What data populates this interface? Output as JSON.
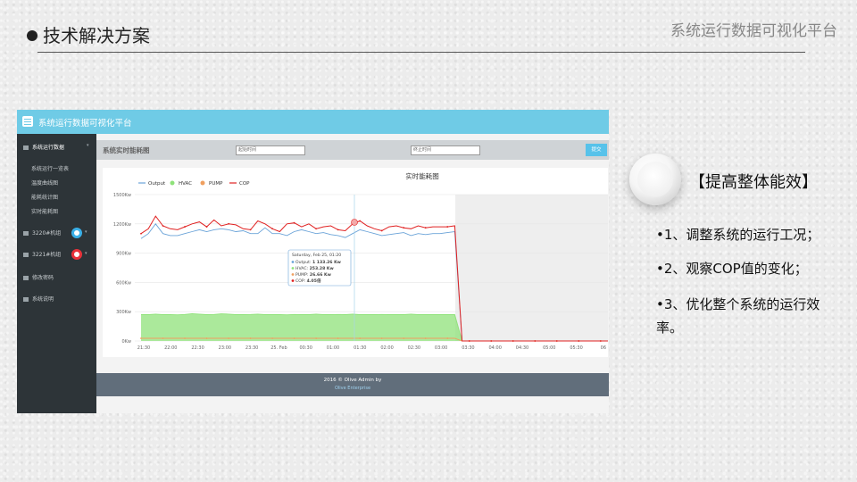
{
  "slide": {
    "title": "技术解决方案",
    "brand": "系统运行数据可视化平台",
    "heading": "【提高整体能效】",
    "bullets": [
      "•1、调整系统的运行工况；",
      "•2、观察COP值的变化；",
      "•3、优化整个系统的运行效率。"
    ]
  },
  "app": {
    "title": "系统运行数据可视化平台",
    "sidebar": {
      "section": "系统运行数据",
      "subitems": [
        "系统运行一览表",
        "温度曲线图",
        "能耗统计图",
        "实时能耗图"
      ],
      "units": [
        {
          "label": "3220#机组",
          "ring_color": "#3ab0e8"
        },
        {
          "label": "3221#机组",
          "ring_color": "#e8323a"
        }
      ],
      "password": "修改密码",
      "manual": "系统说明"
    },
    "filter": {
      "label": "系统实时能耗图",
      "start_placeholder": "起始时间",
      "end_placeholder": "终止时间",
      "submit": "提交"
    },
    "footer": {
      "line1": "2016 © Olive Admin by",
      "line2": "Olive Enterprise"
    }
  },
  "chart_data": {
    "type": "line",
    "title": "实时能耗图",
    "xlabels": [
      "21:30",
      "22:00",
      "22:30",
      "23:00",
      "23:30",
      "25. Feb",
      "00:30",
      "01:00",
      "01:30",
      "02:00",
      "02:30",
      "03:00",
      "03:30",
      "04:00",
      "04:30",
      "05:00",
      "05:30",
      "06"
    ],
    "yticks": [
      "1500Kw",
      "1200Kw",
      "900Kw",
      "600Kw",
      "300Kw",
      "0Kw"
    ],
    "ylim": [
      0,
      1500
    ],
    "series": [
      {
        "name": "Output",
        "color": "#6aa3d8",
        "values": [
          1050,
          1100,
          1200,
          1100,
          1080,
          1080,
          1100,
          1120,
          1140,
          1120,
          1140,
          1150,
          1140,
          1120,
          1130,
          1100,
          1100,
          1160,
          1100,
          1100,
          1080,
          1120,
          1140,
          1120,
          1100,
          1110,
          1090,
          1080,
          1060,
          1100,
          1140,
          1120,
          1100,
          1080,
          1090,
          1100,
          1110,
          1080,
          1100,
          1090,
          1100,
          1100,
          1110,
          1120,
          0,
          0,
          0,
          0,
          0,
          0,
          0,
          0,
          0,
          0,
          0,
          0,
          0,
          0,
          0,
          0,
          0,
          0,
          0,
          0,
          0
        ]
      },
      {
        "name": "HVAC",
        "color": "#8fe27a",
        "values": [
          270,
          270,
          275,
          270,
          270,
          268,
          272,
          280,
          275,
          270,
          272,
          278,
          275,
          270,
          270,
          272,
          275,
          270,
          270,
          270,
          268,
          272,
          270,
          270,
          275,
          270,
          270,
          272,
          270,
          275,
          270,
          270,
          270,
          272,
          270,
          270,
          270,
          275,
          270,
          270,
          270,
          270,
          270,
          270,
          0,
          0,
          0,
          0,
          0,
          0,
          0,
          0,
          0,
          0,
          0,
          0,
          0,
          0,
          0,
          0,
          0,
          0,
          0,
          0,
          0
        ]
      },
      {
        "name": "PUMP",
        "color": "#f0a060",
        "values": [
          27,
          27,
          27,
          27,
          27,
          27,
          27,
          27,
          27,
          27,
          27,
          27,
          27,
          27,
          27,
          27,
          27,
          27,
          27,
          27,
          27,
          27,
          27,
          27,
          27,
          27,
          27,
          27,
          27,
          27,
          27,
          27,
          27,
          27,
          27,
          27,
          27,
          27,
          27,
          27,
          27,
          27,
          27,
          27,
          0,
          0,
          0,
          0,
          0,
          0,
          0,
          0,
          0,
          0,
          0,
          0,
          0,
          0,
          0,
          0,
          0,
          0,
          0,
          0,
          0
        ]
      },
      {
        "name": "COP",
        "color": "#e02020",
        "values": [
          1100,
          1150,
          1280,
          1180,
          1150,
          1140,
          1170,
          1200,
          1220,
          1170,
          1240,
          1180,
          1200,
          1190,
          1150,
          1140,
          1230,
          1200,
          1150,
          1120,
          1200,
          1210,
          1170,
          1200,
          1150,
          1170,
          1180,
          1140,
          1130,
          1200,
          1230,
          1180,
          1150,
          1130,
          1170,
          1180,
          1160,
          1150,
          1180,
          1160,
          1170,
          1170,
          1170,
          1180,
          0,
          0,
          0,
          0,
          0,
          0,
          0,
          0,
          0,
          0,
          0,
          0,
          0,
          0,
          0,
          0,
          0,
          0,
          0,
          0,
          0
        ]
      }
    ],
    "tooltip": {
      "title": "Saturday, Feb 25, 01:20",
      "rows": [
        {
          "label": "Output:",
          "value": "1 133.26 Kw",
          "color": "#6aa3d8"
        },
        {
          "label": "HVAC:",
          "value": "253.28 Kw",
          "color": "#8fe27a"
        },
        {
          "label": "PUMP:",
          "value": "26.66 Kw",
          "color": "#f0a060"
        },
        {
          "label": "COP:",
          "value": "4.05倍",
          "color": "#e02020"
        }
      ]
    }
  }
}
